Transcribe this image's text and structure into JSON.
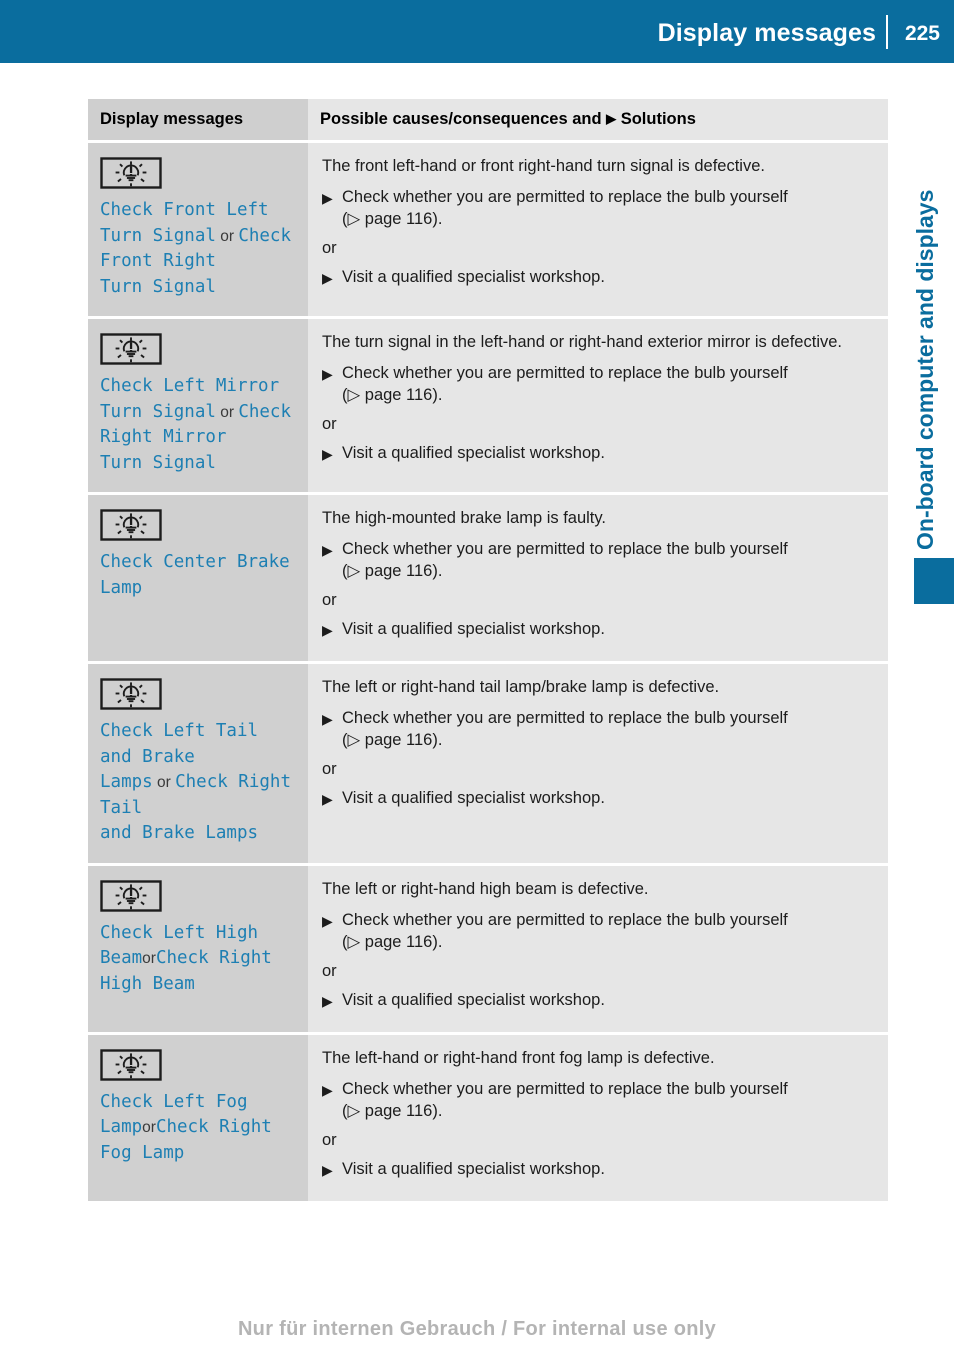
{
  "header": {
    "title": "Display messages",
    "page_number": "225"
  },
  "side_tab": {
    "chapter_label": "On-board computer and displays",
    "accent_color": "#0a6d9e"
  },
  "table": {
    "columns": [
      {
        "key": "message",
        "label": "Display messages"
      },
      {
        "key": "solution",
        "label_prefix": "Possible causes/consequences and ",
        "label_suffix": " Solutions",
        "bullet": "▶"
      }
    ],
    "rows": [
      {
        "icon": "bulb-fault-icon",
        "messages": [
          {
            "code": "Check Front Left\nTurn Signal",
            "connector": " or "
          },
          {
            "code": "Check Front Right\nTurn Signal",
            "connector": ""
          }
        ],
        "cause": "The front left-hand or front right-hand turn signal is defective.",
        "steps": [
          {
            "bullet": "▶",
            "text": "Check whether you are permitted to replace the bulb yourself",
            "reference": "(▷ page 116)."
          },
          {
            "separator": "or"
          },
          {
            "bullet": "▶",
            "text": "Visit a qualified specialist workshop.",
            "reference": ""
          }
        ]
      },
      {
        "icon": "bulb-fault-icon",
        "messages": [
          {
            "code": "Check Left Mirror\nTurn Signal",
            "connector": " or "
          },
          {
            "code": "Check Right Mirror\nTurn Signal",
            "connector": ""
          }
        ],
        "cause": "The turn signal in the left-hand or right-hand exterior mirror is defective.",
        "steps": [
          {
            "bullet": "▶",
            "text": "Check whether you are permitted to replace the bulb yourself",
            "reference": "(▷ page 116)."
          },
          {
            "separator": "or"
          },
          {
            "bullet": "▶",
            "text": "Visit a qualified specialist workshop.",
            "reference": ""
          }
        ]
      },
      {
        "icon": "bulb-fault-icon",
        "messages": [
          {
            "code": "Check Center Brake\nLamp",
            "connector": ""
          }
        ],
        "cause": "The high-mounted brake lamp is faulty.",
        "steps": [
          {
            "bullet": "▶",
            "text": "Check whether you are permitted to replace the bulb yourself",
            "reference": "(▷ page 116)."
          },
          {
            "separator": "or"
          },
          {
            "bullet": "▶",
            "text": "Visit a qualified specialist workshop.",
            "reference": ""
          }
        ]
      },
      {
        "icon": "bulb-fault-icon",
        "messages": [
          {
            "code": "Check Left Tail\nand Brake Lamps",
            "connector": " or "
          },
          {
            "code": "Check Right Tail\nand Brake Lamps",
            "connector": ""
          }
        ],
        "cause": "The left or right-hand tail lamp/brake lamp is defective.",
        "steps": [
          {
            "bullet": "▶",
            "text": "Check whether you are permitted to replace the bulb yourself",
            "reference": "(▷ page 116)."
          },
          {
            "separator": "or"
          },
          {
            "bullet": "▶",
            "text": "Visit a qualified specialist workshop.",
            "reference": ""
          }
        ]
      },
      {
        "icon": "bulb-fault-icon",
        "messages": [
          {
            "code": "Check Left High\nBeam",
            "connector": "or"
          },
          {
            "code": "Check Right\nHigh Beam",
            "connector": ""
          }
        ],
        "cause": "The left or right-hand high beam is defective.",
        "steps": [
          {
            "bullet": "▶",
            "text": "Check whether you are permitted to replace the bulb yourself",
            "reference": "(▷ page 116)."
          },
          {
            "separator": "or"
          },
          {
            "bullet": "▶",
            "text": "Visit a qualified specialist workshop.",
            "reference": ""
          }
        ]
      },
      {
        "icon": "bulb-fault-icon",
        "messages": [
          {
            "code": "Check Left Fog\nLamp",
            "connector": "or"
          },
          {
            "code": "Check Right\nFog Lamp",
            "connector": ""
          }
        ],
        "cause": "The left-hand or right-hand front fog lamp is defective.",
        "steps": [
          {
            "bullet": "▶",
            "text": "Check whether you are permitted to replace the bulb yourself",
            "reference": "(▷ page 116)."
          },
          {
            "separator": "or"
          },
          {
            "bullet": "▶",
            "text": "Visit a qualified specialist workshop.",
            "reference": ""
          }
        ]
      }
    ]
  },
  "footer": {
    "watermark": "Nur für internen Gebrauch / For internal use only"
  },
  "colors": {
    "header_blue": "#0a6d9e",
    "message_code_blue": "#1d7fb3",
    "col_message_bg": "#d0d0d0",
    "col_solution_bg": "#e6e6e6"
  }
}
